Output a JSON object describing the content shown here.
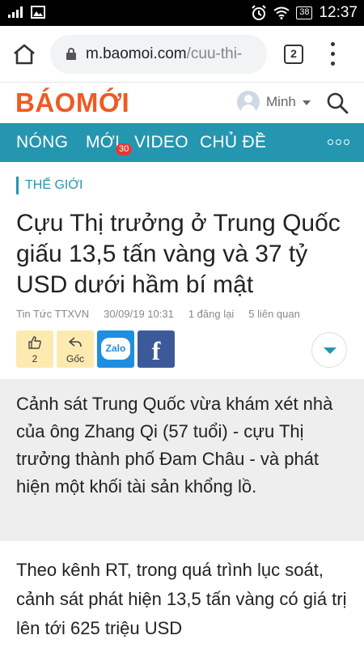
{
  "status_bar": {
    "battery": "38",
    "time": "12:37"
  },
  "browser": {
    "url_host": "m.baomoi.com",
    "url_path": "/cuu-thi-",
    "tab_count": "2"
  },
  "site": {
    "logo": "BÁOMỚI",
    "user_name": "Minh"
  },
  "nav": {
    "items": [
      {
        "label": "NÓNG"
      },
      {
        "label": "MỚI"
      },
      {
        "label": "VIDEO"
      },
      {
        "label": "CHỦ ĐỀ"
      }
    ],
    "new_badge": "30"
  },
  "article": {
    "category": "THẾ GIỚI",
    "title": "Cựu Thị trưởng ở Trung Quốc giấu 13,5 tấn vàng và 37 tỷ USD dưới hầm bí mật",
    "source": "Tin Tức TTXVN",
    "datetime": "30/09/19 10:31",
    "reposts": "1 đăng lại",
    "related": "5 liên quan",
    "like_count": "2",
    "origin_label": "Gốc",
    "zalo_label": "Zalo",
    "facebook_label": "f",
    "lead": "Cảnh sát Trung Quốc vừa khám xét nhà của ông Zhang Qi (57 tuổi) - cựu Thị trưởng thành phố Đam Châu - và phát hiện một khối tài sản khổng lồ.",
    "body": "Theo kênh RT, trong quá trình lục soát, cảnh sát phát hiện 13,5 tấn vàng có giá trị lên tới 625 triệu USD"
  },
  "colors": {
    "brand_orange": "#ee5a24",
    "nav_teal": "#2596b0",
    "badge_red": "#e53935",
    "zalo_blue": "#1f8ee0",
    "facebook_blue": "#3c5a99",
    "action_yellow": "#fdeab0"
  },
  "icons": [
    "signal-icon",
    "image-icon",
    "alarm-icon",
    "wifi-icon",
    "battery-icon",
    "home-icon",
    "lock-icon",
    "tabs-icon",
    "menu-icon",
    "avatar-icon",
    "search-icon",
    "more-icon",
    "like-icon",
    "reply-icon",
    "zalo-icon",
    "facebook-icon",
    "chevron-down-icon"
  ]
}
